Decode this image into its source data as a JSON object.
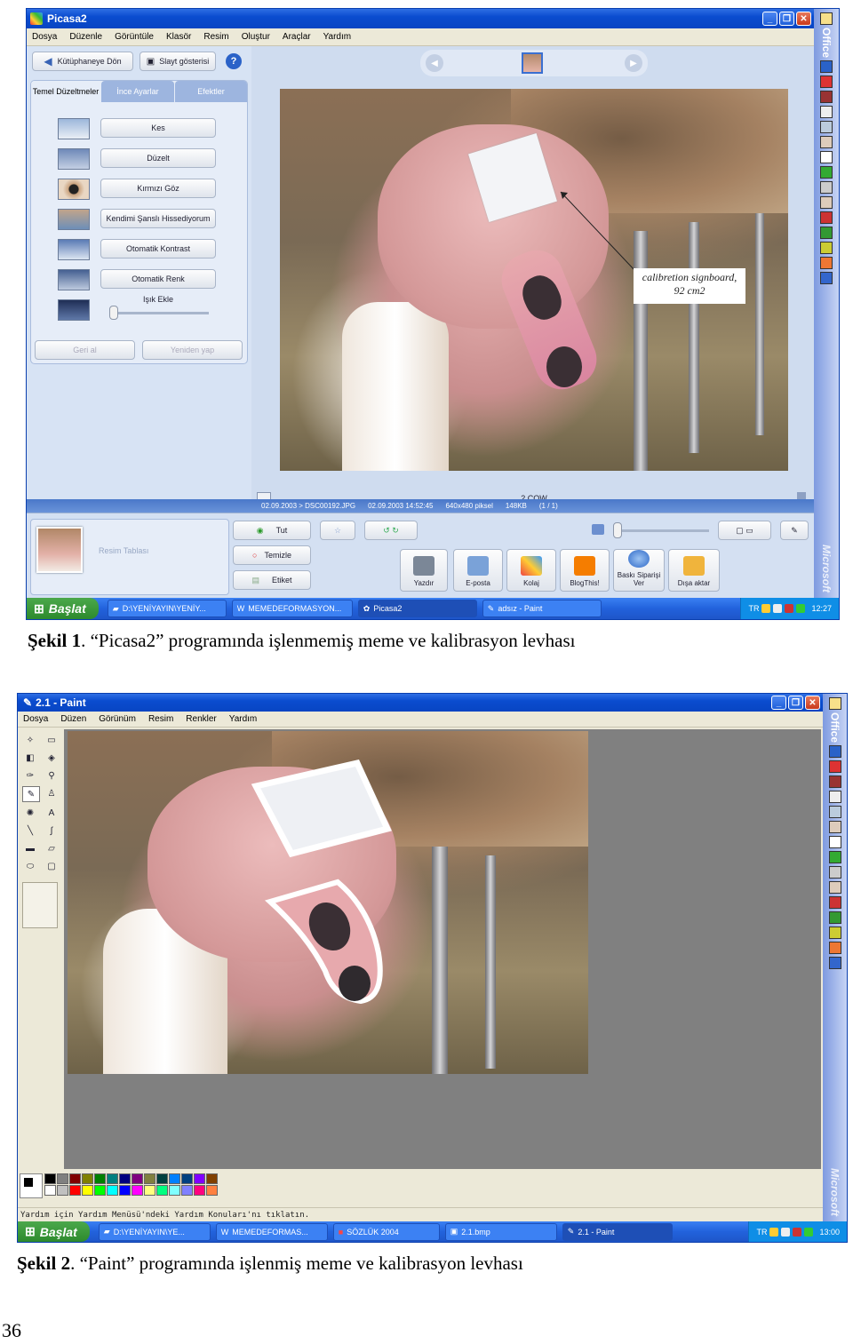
{
  "picasa": {
    "title": "Picasa2",
    "menu": [
      "Dosya",
      "Düzenle",
      "Görüntüle",
      "Klasör",
      "Resim",
      "Oluştur",
      "Araçlar",
      "Yardım"
    ],
    "back_label": "Kütüphaneye Dön",
    "slideshow_label": "Slayt gösterisi",
    "help_glyph": "?",
    "tabs": [
      "Temel Düzeltmeler",
      "İnce Ayarlar",
      "Efektler"
    ],
    "fixes": [
      "Kes",
      "Düzelt",
      "Kırmızı Göz",
      "Kendimi Şanslı Hissediyorum",
      "Otomatik Kontrast",
      "Otomatik Renk"
    ],
    "light_label": "Işık Ekle",
    "undo_label": "Geri al",
    "redo_label": "Yeniden yap",
    "filename": "2.COW",
    "status": {
      "path": "02.09.2003 > DSC00192.JPG",
      "date": "02.09.2003 14:52:45",
      "dims": "640x480 piksel",
      "size": "148KB",
      "index": "(1 / 1)"
    },
    "annotation": [
      "calibretion signboard,",
      "92 cm2"
    ],
    "tray_label": "Resim Tablası",
    "hold_label": "Tut",
    "clear_label": "Temizle",
    "tag_label": "Etiket",
    "actions": [
      "Yazdır",
      "E-posta",
      "Kolaj",
      "BlogThis!",
      "Baskı Siparişi Ver",
      "Dışa aktar"
    ],
    "office_label": "Office",
    "microsoft_label": "Microsoft"
  },
  "taskbar1": {
    "start": "Başlat",
    "tasks": [
      "D:\\YENİYAYIN\\YENİY...",
      "MEMEDEFORMASYON...",
      "Picasa2",
      "adsız - Paint"
    ],
    "lang": "TR",
    "clock": "12:27"
  },
  "caption1": {
    "label": "Şekil 1",
    "text": ". “Picasa2” programında işlenmemiş meme ve kalibrasyon levhası"
  },
  "paint": {
    "title": "2.1 - Paint",
    "menu": [
      "Dosya",
      "Düzen",
      "Görünüm",
      "Resim",
      "Renkler",
      "Yardım"
    ],
    "status_text": "Yardım için Yardım Menüsü'ndeki Yardım Konuları'nı tıklatın.",
    "office_label": "Office",
    "microsoft_label": "Microsoft",
    "palette": [
      "#000000",
      "#808080",
      "#800000",
      "#808000",
      "#008000",
      "#008080",
      "#000080",
      "#800080",
      "#808040",
      "#004040",
      "#0080ff",
      "#004080",
      "#8000ff",
      "#804000",
      "#ffffff",
      "#c0c0c0",
      "#ff0000",
      "#ffff00",
      "#00ff00",
      "#00ffff",
      "#0000ff",
      "#ff00ff",
      "#ffff80",
      "#00ff80",
      "#80ffff",
      "#8080ff",
      "#ff0080",
      "#ff8040"
    ]
  },
  "taskbar2": {
    "start": "Başlat",
    "tasks": [
      "D:\\YENİYAYIN\\YE...",
      "MEMEDEFORMAS...",
      "SÖZLÜK 2004",
      "2.1.bmp",
      "2.1 - Paint"
    ],
    "lang": "TR",
    "clock": "13:00"
  },
  "caption2": {
    "label": "Şekil 2",
    "text": ". “Paint” programında işlenmiş meme ve kalibrasyon levhası"
  },
  "page_number": "36",
  "colors": {
    "xp_blue": "#0a4ccf",
    "picasa_panel": "#d7e3f4",
    "paint_canvas_bg": "#808080"
  }
}
